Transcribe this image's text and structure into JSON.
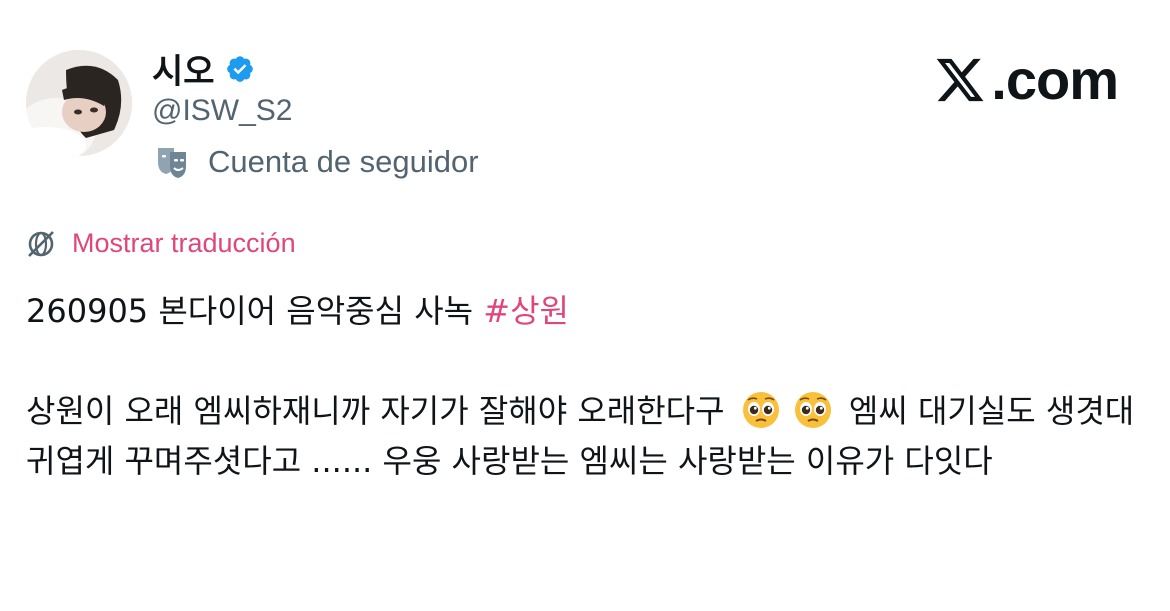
{
  "author": {
    "display_name": "시오",
    "handle": "@ISW_S2",
    "account_type": "Cuenta de seguidor",
    "verified_icon": "verified-badge-icon",
    "account_type_icon": "theater-mask-icon"
  },
  "brand": {
    "text": ".com",
    "logo_icon": "x-logo-icon"
  },
  "translate": {
    "label": "Mostrar traducción",
    "icon": "globe-translate-icon"
  },
  "tweet": {
    "line1_prefix": "260905 본다이어 음악중심 사녹 ",
    "hashtag": "#상원",
    "para2_part1": "상원이 오래 엠씨하재니까 자기가 잘해야 오래한다구",
    "para2_part2": "엠씨 대기실도 생겻대 귀엽게 꾸며주셧다고 ...... 우웅 사랑받는 엠씨는 사랑받는 이유가 다잇다",
    "emoji_name": "pleading-face-emoji"
  },
  "colors": {
    "accent_pink": "#e0467c",
    "verified_blue": "#1d9bf0",
    "secondary_text": "#536471",
    "primary_text": "#0f1419"
  }
}
